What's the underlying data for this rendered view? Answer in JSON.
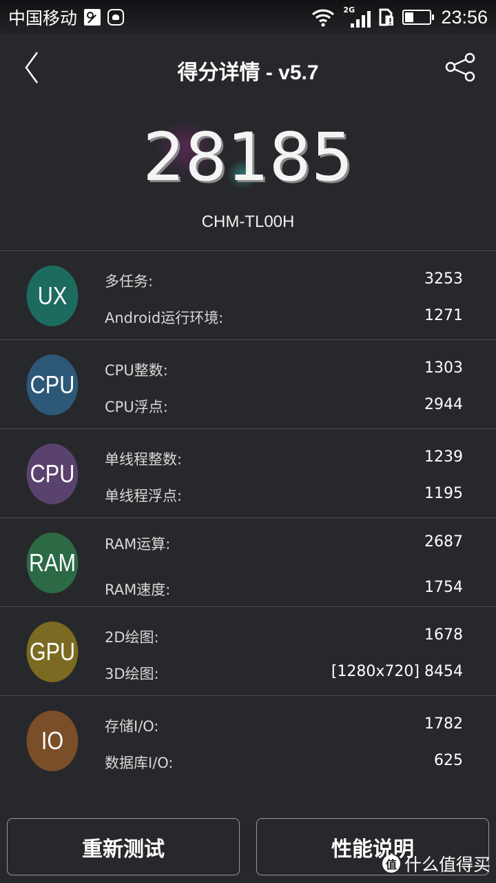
{
  "statusbar": {
    "carrier": "中国移动",
    "network_type": "2G",
    "time": "23:56",
    "battery_level": 0.4,
    "icons": [
      "image-icon",
      "huawei-icon",
      "wifi-icon",
      "signal-icon",
      "sim-alert-icon",
      "battery-icon"
    ]
  },
  "header": {
    "title": "得分详情 - v5.7",
    "back_icon": "chevron-left-icon",
    "share_icon": "share-icon"
  },
  "score": {
    "total": "28185",
    "device": "CHM-TL00H"
  },
  "categories": [
    {
      "badge": "UX",
      "color": "#1d6b5f",
      "items": [
        {
          "label": "多任务:",
          "value": "3253"
        },
        {
          "label": "Android运行环境:",
          "value": "1271"
        }
      ]
    },
    {
      "badge": "CPU",
      "color": "#2d5878",
      "items": [
        {
          "label": "CPU整数:",
          "value": "1303"
        },
        {
          "label": "CPU浮点:",
          "value": "2944"
        }
      ]
    },
    {
      "badge": "CPU",
      "color": "#5a426e",
      "items": [
        {
          "label": "单线程整数:",
          "value": "1239"
        },
        {
          "label": "单线程浮点:",
          "value": "1195"
        }
      ]
    },
    {
      "badge": "RAM",
      "color": "#2c6a45",
      "items": [
        {
          "label": "RAM运算:",
          "value": "2687"
        },
        {
          "label": "RAM速度:",
          "value": "1754"
        }
      ]
    },
    {
      "badge": "GPU",
      "color": "#7b6b22",
      "items": [
        {
          "label": "2D绘图:",
          "value": "1678"
        },
        {
          "label": "3D绘图:",
          "value": "[1280x720] 8454"
        }
      ]
    },
    {
      "badge": "IO",
      "color": "#7a4e29",
      "items": [
        {
          "label": "存储I/O:",
          "value": "1782"
        },
        {
          "label": "数据库I/O:",
          "value": "625"
        }
      ]
    }
  ],
  "buttons": {
    "retest": "重新测试",
    "info": "性能说明"
  },
  "watermark": {
    "logo": "值",
    "text": "什么值得买"
  }
}
